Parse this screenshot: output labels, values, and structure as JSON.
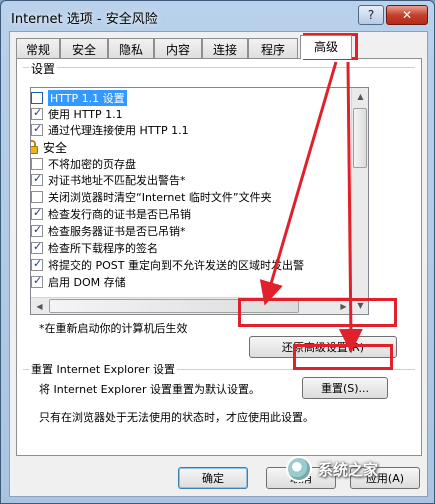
{
  "window": {
    "title": "Internet 选项 - 安全风险",
    "help_label": "?",
    "close_label": "✕"
  },
  "tabs": [
    "常规",
    "安全",
    "隐私",
    "内容",
    "连接",
    "程序",
    "高级"
  ],
  "settings": {
    "group_label": "设置",
    "items": [
      {
        "text": "HTTP 1.1 设置",
        "type": "folder",
        "selected": true
      },
      {
        "text": "使用 HTTP 1.1",
        "type": "checkbox",
        "checked": true
      },
      {
        "text": "通过代理连接使用 HTTP 1.1",
        "type": "checkbox",
        "checked": true
      },
      {
        "text": "安全",
        "type": "lock"
      },
      {
        "text": "不将加密的页存盘",
        "type": "checkbox",
        "checked": false
      },
      {
        "text": "对证书地址不匹配发出警告*",
        "type": "checkbox",
        "checked": true
      },
      {
        "text": "关闭浏览器时清空“Internet 临时文件”文件夹",
        "type": "checkbox",
        "checked": false
      },
      {
        "text": "检查发行商的证书是否已吊销",
        "type": "checkbox",
        "checked": true
      },
      {
        "text": "检查服务器证书是否已吊销*",
        "type": "checkbox",
        "checked": true
      },
      {
        "text": "检查所下载程序的签名",
        "type": "checkbox",
        "checked": true
      },
      {
        "text": "将提交的 POST 重定向到不允许发送的区域时发出警",
        "type": "checkbox",
        "checked": true
      },
      {
        "text": "启用 DOM 存储",
        "type": "checkbox",
        "checked": true
      }
    ],
    "restart_note": "*在重新启动你的计算机后生效",
    "restore_button": "还原高级设置(R)"
  },
  "reset": {
    "group_label": "重置 Internet Explorer 设置",
    "description": "将 Internet Explorer 设置重置为默认设置。",
    "button": "重置(S)...",
    "note": "只有在浏览器处于无法使用的状态时，才应使用此设置。"
  },
  "footer": {
    "ok": "确定",
    "cancel": "取消",
    "apply": "应用(A)"
  },
  "watermark": "系统之家",
  "colors": {
    "annotation_red": "#e0202a",
    "titlebar": "#b9d1ea"
  }
}
